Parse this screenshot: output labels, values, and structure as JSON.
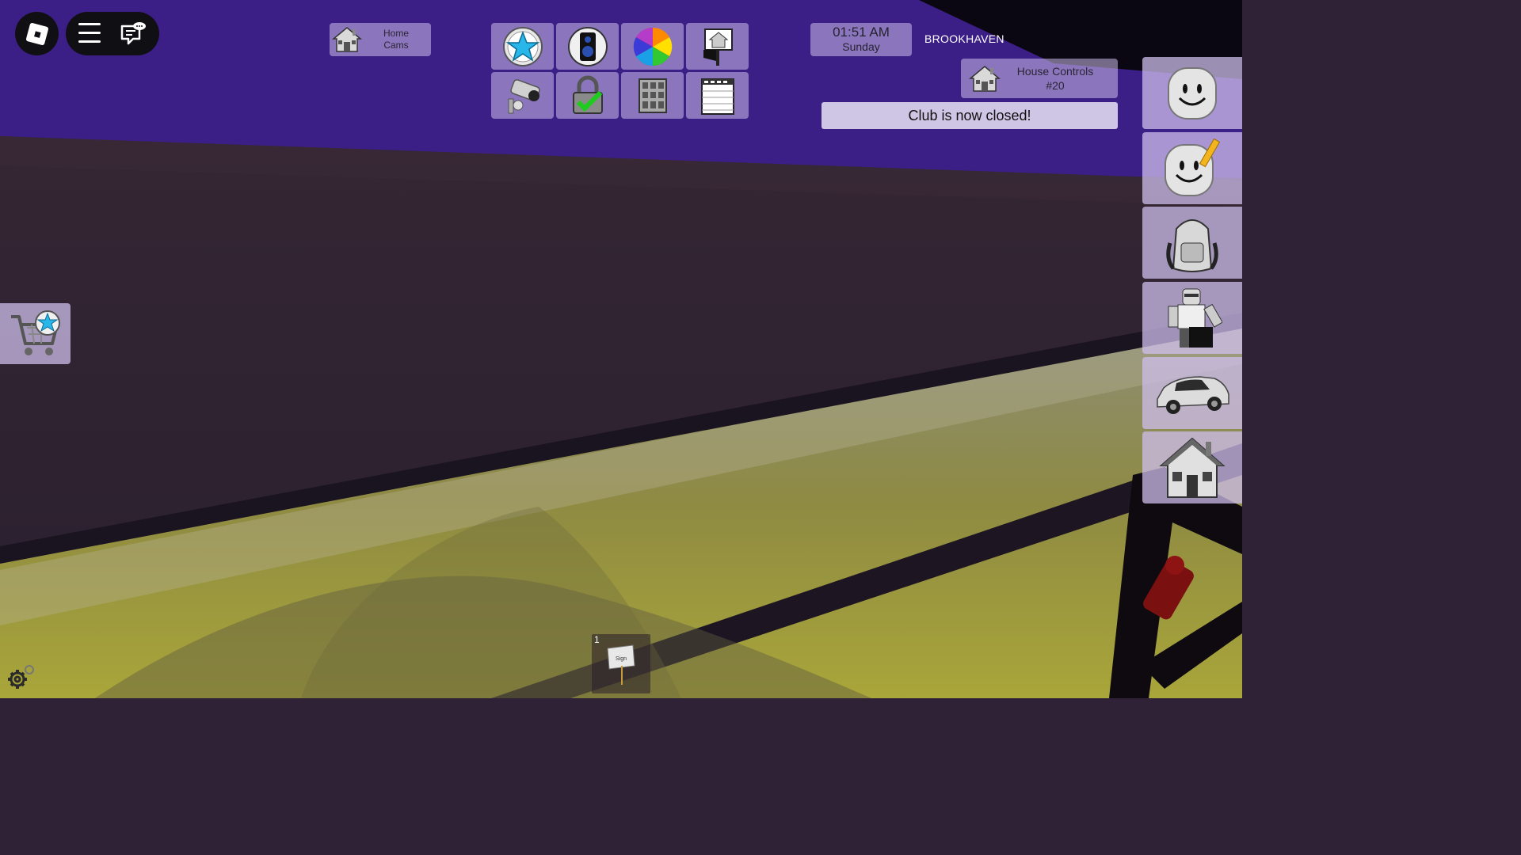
{
  "hud": {
    "home_cams": {
      "line1": "Home",
      "line2": "Cams",
      "icon": "house-icon"
    },
    "clock": {
      "time": "01:51 AM",
      "day": "Sunday"
    },
    "game_title": "BROOKHAVEN",
    "house_controls": {
      "line1": "House Controls",
      "line2": "#20",
      "icon": "house-icon"
    },
    "notice": "Club is now closed!",
    "tool_grid": [
      {
        "name": "star-badge-icon"
      },
      {
        "name": "speaker-icon"
      },
      {
        "name": "color-wheel-icon"
      },
      {
        "name": "house-sign-icon"
      },
      {
        "name": "security-camera-icon"
      },
      {
        "name": "padlock-check-icon"
      },
      {
        "name": "window-grid-icon"
      },
      {
        "name": "garage-door-icon"
      }
    ],
    "sidebar": [
      {
        "name": "avatar-face-icon"
      },
      {
        "name": "avatar-edit-icon"
      },
      {
        "name": "backpack-icon"
      },
      {
        "name": "roleplay-character-icon"
      },
      {
        "name": "car-icon"
      },
      {
        "name": "house-icon"
      }
    ],
    "hotbar": {
      "slot_number": "1",
      "item_label": "Sign"
    }
  }
}
